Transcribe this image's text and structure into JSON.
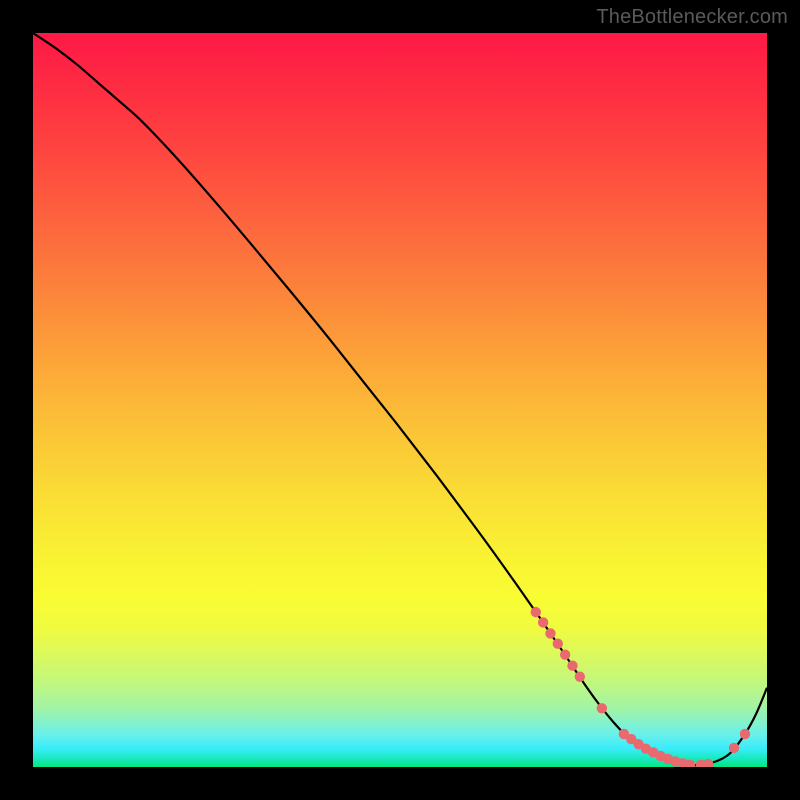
{
  "watermark": "TheBottlenecker.com",
  "colors": {
    "frame_bg": "#000000",
    "line": "#000000",
    "marker": "#e86a6e",
    "watermark": "#5a5a5a",
    "gradient_stops": [
      {
        "offset": 0.0,
        "color": "#fe1946"
      },
      {
        "offset": 0.07,
        "color": "#fe2b42"
      },
      {
        "offset": 0.15,
        "color": "#fe4240"
      },
      {
        "offset": 0.25,
        "color": "#fd623e"
      },
      {
        "offset": 0.35,
        "color": "#fc833b"
      },
      {
        "offset": 0.45,
        "color": "#fca639"
      },
      {
        "offset": 0.55,
        "color": "#fbc637"
      },
      {
        "offset": 0.63,
        "color": "#fadd35"
      },
      {
        "offset": 0.71,
        "color": "#f9f233"
      },
      {
        "offset": 0.77,
        "color": "#f9fc33"
      },
      {
        "offset": 0.81,
        "color": "#f0fb3f"
      },
      {
        "offset": 0.85,
        "color": "#d9f95f"
      },
      {
        "offset": 0.885,
        "color": "#c1f77e"
      },
      {
        "offset": 0.92,
        "color": "#a1f4a6"
      },
      {
        "offset": 0.955,
        "color": "#6bf0ea"
      },
      {
        "offset": 0.975,
        "color": "#39ecfa"
      },
      {
        "offset": 0.99,
        "color": "#15e9b7"
      },
      {
        "offset": 1.0,
        "color": "#04e77f"
      }
    ]
  },
  "chart_data": {
    "type": "line",
    "title": "",
    "xlabel": "",
    "ylabel": "",
    "xlim": [
      0,
      100
    ],
    "ylim": [
      0,
      100
    ],
    "series": [
      {
        "name": "bottleneck-curve",
        "x": [
          0,
          3,
          6,
          9,
          12,
          15,
          20,
          25,
          30,
          35,
          40,
          45,
          50,
          55,
          60,
          63,
          66,
          69,
          72,
          75,
          77,
          79,
          81,
          83,
          85,
          87,
          89,
          91,
          93,
          95,
          97,
          98.5,
          100
        ],
        "y": [
          100,
          98.0,
          95.7,
          93.1,
          90.5,
          87.8,
          82.5,
          76.8,
          70.9,
          64.9,
          58.8,
          52.5,
          46.2,
          39.7,
          33.0,
          28.9,
          24.7,
          20.4,
          16.0,
          11.5,
          8.7,
          6.2,
          4.1,
          2.6,
          1.5,
          0.75,
          0.3,
          0.3,
          0.75,
          1.9,
          4.5,
          7.2,
          10.8
        ]
      }
    ],
    "markers": {
      "name": "highlight-points",
      "x": [
        68.5,
        69.5,
        70.5,
        71.5,
        72.5,
        73.5,
        74.5,
        77.5,
        80.5,
        81.5,
        82.5,
        83.5,
        84.5,
        85.5,
        86.5,
        87.5,
        88.5,
        89.5,
        91.0,
        92.0,
        95.5,
        97.0
      ],
      "y": [
        21.1,
        19.7,
        18.2,
        16.8,
        15.3,
        13.8,
        12.3,
        8.0,
        4.5,
        3.8,
        3.1,
        2.5,
        2.0,
        1.5,
        1.1,
        0.75,
        0.5,
        0.3,
        0.3,
        0.4,
        2.6,
        4.5
      ]
    }
  }
}
